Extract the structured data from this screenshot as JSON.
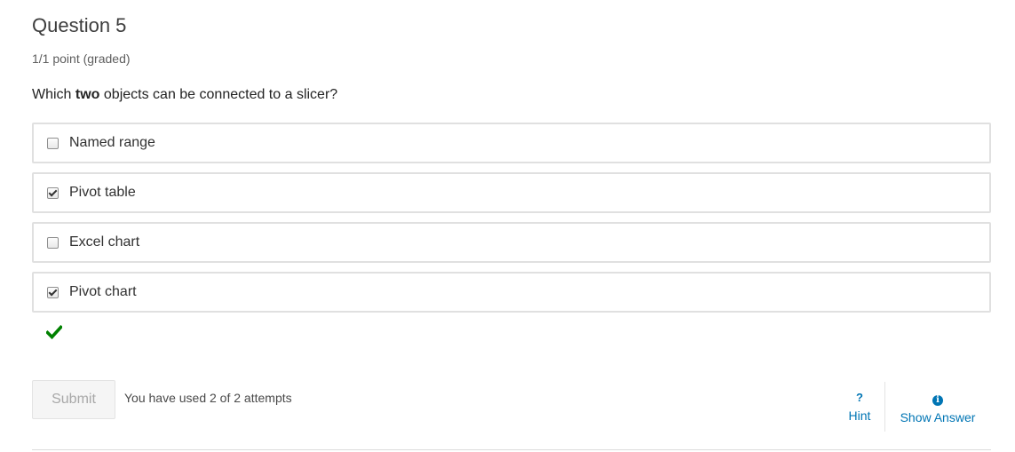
{
  "problem": {
    "title": "Question 5",
    "score": "1/1 point (graded)",
    "prompt_before": "Which ",
    "prompt_bold": "two",
    "prompt_after": " objects can be connected to a slicer?"
  },
  "choices": [
    {
      "label": "Named range",
      "checked": false
    },
    {
      "label": "Pivot table",
      "checked": true
    },
    {
      "label": "Excel chart",
      "checked": false
    },
    {
      "label": "Pivot chart",
      "checked": true
    }
  ],
  "status": {
    "icon": "check-icon",
    "color": "#008100"
  },
  "actions": {
    "submit_label": "Submit",
    "attempts_text": "You have used 2 of 2 attempts",
    "hint_icon": "?",
    "hint_label": "Hint",
    "show_answer_icon": "i",
    "show_answer_label": "Show Answer",
    "link_color": "#0075b4"
  }
}
